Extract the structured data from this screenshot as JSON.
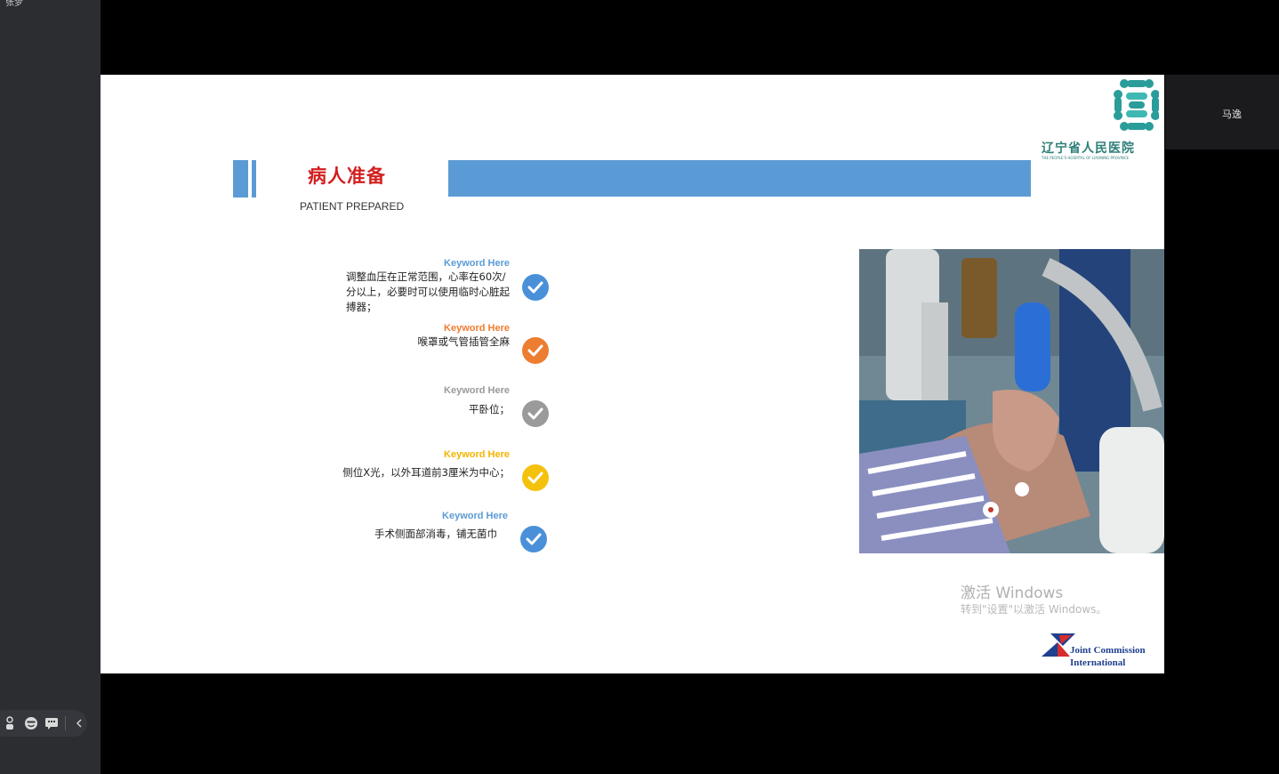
{
  "sidebar": {
    "top_label": "张梦"
  },
  "participant": {
    "name": "马逸"
  },
  "slide": {
    "title": "病人准备",
    "subtitle": "PATIENT PREPARED",
    "hospital_name": "辽宁省人民医院",
    "hospital_en": "THE PEOPLE'S HOSPITAL OF LIAONING PROVINCE",
    "items": [
      {
        "keyword": "Keyword Here",
        "keyword_color": "#5b9bd5",
        "text": "调整血压在正常范围，心率在60次/分以上，必要时可以使用临时心脏起搏器；",
        "check_color": "#4a90d9"
      },
      {
        "keyword": "Keyword Here",
        "keyword_color": "#ed7d31",
        "text": "喉罩或气管插管全麻",
        "check_color": "#ed7d31"
      },
      {
        "keyword": "Keyword Here",
        "keyword_color": "#9a9a9a",
        "text": "平卧位；",
        "check_color": "#9a9a9a"
      },
      {
        "keyword": "Keyword Here",
        "keyword_color": "#f4b400",
        "text": "侧位X光，以外耳道前3厘米为中心；",
        "check_color": "#f4c20d"
      },
      {
        "keyword": "Keyword Here",
        "keyword_color": "#5b9bd5",
        "text": "手术侧面部消毒，铺无菌巾",
        "check_color": "#4a90d9"
      }
    ],
    "item1_lines": [
      "调整血压在正常范围，心率在60次/",
      "分以上，必要时可以使用临时心脏起",
      "搏器；"
    ],
    "watermark_title": "激活 Windows",
    "watermark_sub": "转到\"设置\"以激活 Windows。",
    "jci_line1": "Joint Commission",
    "jci_line2": "International"
  },
  "toolbar": {
    "icons": [
      "person-icon",
      "emoji-icon",
      "chat-icon",
      "chevron-left-icon"
    ]
  }
}
